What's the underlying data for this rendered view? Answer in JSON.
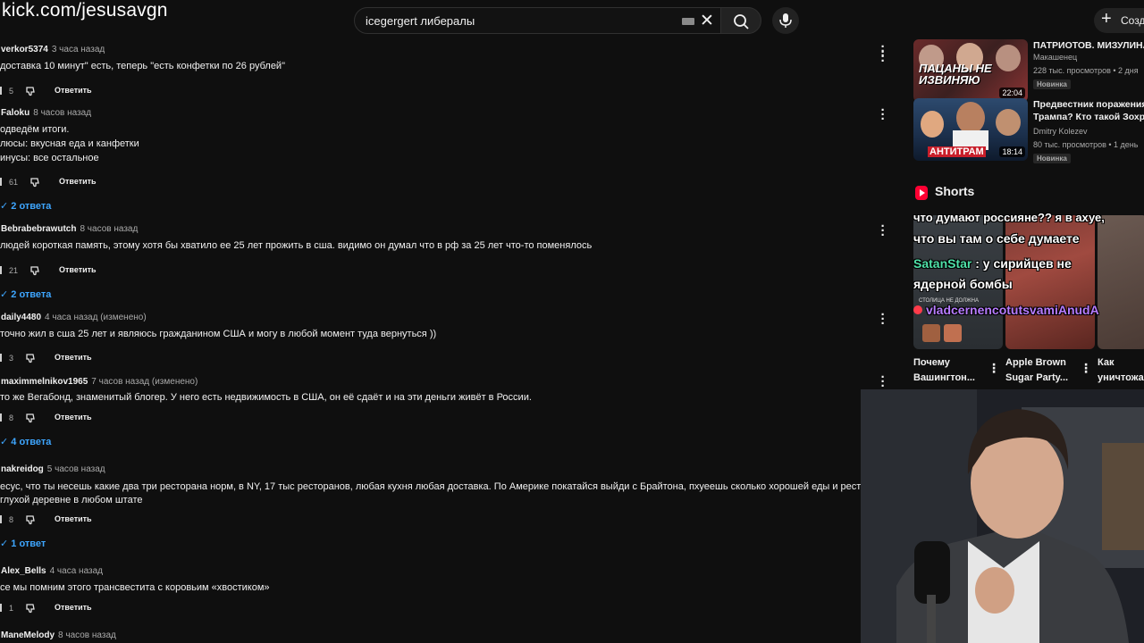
{
  "stream_overlay": {
    "url": "kick.com/jesusavgn"
  },
  "search": {
    "query": "icegergert либералы"
  },
  "header": {
    "create_label": "Созд"
  },
  "comments": [
    {
      "author": "verkor5374",
      "time": "3 часа назад",
      "lines": [
        "доставка 10 минут\" есть, теперь \"есть конфетки по 26 рублей\""
      ],
      "likes": "5",
      "reply": "Ответить",
      "replies": ""
    },
    {
      "author": "Faloku",
      "time": "8 часов назад",
      "lines": [
        "одведём итоги.",
        "люсы: вкусная еда и канфетки",
        "инусы: все остальное"
      ],
      "likes": "61",
      "reply": "Ответить",
      "replies": "2 ответа"
    },
    {
      "author": "Bebrabebrawutch",
      "time": "8 часов назад",
      "lines": [
        "людей короткая память, этому хотя бы хватило ее 25 лет прожить в сша. видимо он думал что в рф за 25 лет что-то поменялось"
      ],
      "likes": "21",
      "reply": "Ответить",
      "replies": "2 ответа"
    },
    {
      "author": "daily4480",
      "time": "4 часа назад (изменено)",
      "lines": [
        "точно жил в сша 25 лет и являюсь гражданином США и могу в любой момент туда вернуться ))"
      ],
      "likes": "3",
      "reply": "Ответить",
      "replies": ""
    },
    {
      "author": "maximmelnikov1965",
      "time": "7 часов назад (изменено)",
      "lines": [
        "то же Вегабонд, знаменитый блогер. У него есть недвижимость в США, он её сдаёт и на эти деньги живёт в России."
      ],
      "likes": "8",
      "reply": "Ответить",
      "replies": "4 ответа"
    },
    {
      "author": "nakreidog",
      "time": "5 часов назад",
      "lines": [
        "есус, что ты несешь какие два три ресторана норм, в NY, 17 тыс ресторанов, любая кухня любая доставка. По Америке покатайся выйди с Брайтона, пхуеешь сколько хорошей еды и ресторан",
        "глухой деревне в любом штате"
      ],
      "likes": "8",
      "reply": "Ответить",
      "replies": "1 ответ"
    },
    {
      "author": "Alex_Bells",
      "time": "4 часа назад",
      "lines": [
        "се мы помним этого трансвестита с коровьим «хвостиком»"
      ],
      "likes": "1",
      "reply": "Ответить",
      "replies": ""
    },
    {
      "author": "ManeMelody",
      "time": "8 часов назад",
      "lines": [],
      "likes": "",
      "reply": "",
      "replies": ""
    }
  ],
  "recommendations": [
    {
      "title": "ПАТРИОТОВ. МИЗУЛИНА",
      "channel": "Макашенец",
      "stats": "228 тыс. просмотров • 2 дня",
      "badge": "Новинка",
      "duration": "22:04",
      "thumb_text": "ПАЦАНЫ НЕ ИЗВИНЯЮ"
    },
    {
      "title": "Предвестник поражения Трампа? Кто такой Зохра",
      "title_lines": [
        "Предвестник поражения",
        "Трампа? Кто такой Зохра"
      ],
      "channel": "Dmitry Kolezev",
      "stats": "80 тыс. просмотров • 1 день",
      "badge": "Новинка",
      "duration": "18:14",
      "thumb_text": "АНТИТРАМ"
    }
  ],
  "shorts": {
    "heading": "Shorts",
    "items": [
      {
        "title_lines": [
          "Почему",
          "Вашингтон..."
        ]
      },
      {
        "title_lines": [
          "Apple Brown",
          "Sugar Party..."
        ]
      },
      {
        "title_lines": [
          "Как",
          "уничтожа"
        ]
      }
    ]
  },
  "chat_overlay": {
    "line1": "что думают россияне?? я в ахуе,",
    "line2": "что вы там о себе думаете",
    "user1": "SatanStar",
    "msg1": ": у сирийцев не",
    "msg1b": "ядерной бомбы",
    "user2": "vladcernencotutsvamiAnudA",
    "sign_text": "СТОЛИЦА НЕ ДОЛЖНА"
  },
  "colors": {
    "background": "#0f0f0f",
    "link": "#3ea6ff",
    "accent": "#ff0033",
    "satan": "#4fe0a8",
    "vlad": "#b77cff"
  }
}
